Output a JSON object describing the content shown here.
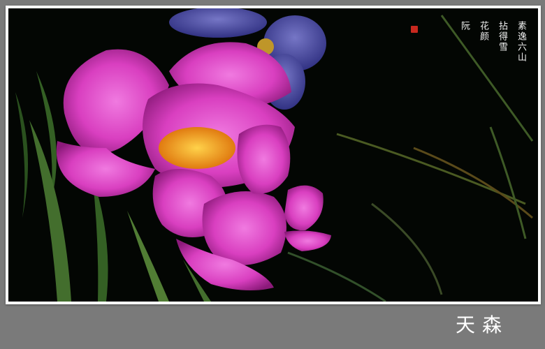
{
  "photo": {
    "subject": "pink-peony-icon",
    "colors": {
      "background": "#030603",
      "petal": "#d93fc0",
      "petal_highlight": "#f07ae0",
      "stamen": "#f5a21a",
      "back_flower": "#5f5fc8",
      "leaf": "#4a7a32"
    }
  },
  "inscription": {
    "columns": [
      "素逸六山",
      "拈得雪",
      "花颜",
      "阮"
    ],
    "seal_color": "#c8281e"
  },
  "signature": {
    "text": "天森"
  },
  "frame": {
    "mat_color": "#7a7a7a",
    "border_color": "#ffffff"
  }
}
